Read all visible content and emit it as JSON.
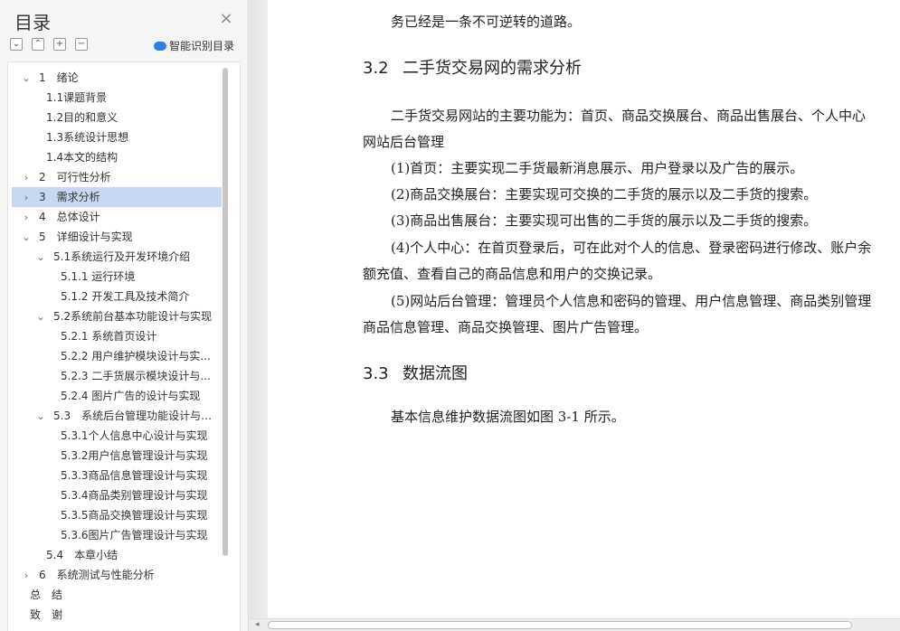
{
  "sidebar": {
    "title": "目录",
    "close_glyph": "×",
    "toolbar": [
      "⌄",
      "⌃",
      "+",
      "−"
    ],
    "smart_toc_label": "智能识别目录",
    "toc": [
      {
        "caret": "⌄",
        "label": "1　绪论",
        "indent": 0
      },
      {
        "caret": "",
        "label": "1.1课题背景",
        "indent": 2
      },
      {
        "caret": "",
        "label": "1.2目的和意义",
        "indent": 2
      },
      {
        "caret": "",
        "label": "1.3系统设计思想",
        "indent": 2
      },
      {
        "caret": "",
        "label": "1.4本文的结构",
        "indent": 2
      },
      {
        "caret": "›",
        "label": "2　可行性分析",
        "indent": 0
      },
      {
        "caret": "›",
        "label": "3　需求分析",
        "indent": 0,
        "active": true
      },
      {
        "caret": "›",
        "label": "4　总体设计",
        "indent": 0
      },
      {
        "caret": "⌄",
        "label": "5　详细设计与实现",
        "indent": 0
      },
      {
        "caret": "⌄",
        "label": "5.1系统运行及开发环境介绍",
        "indent": 1
      },
      {
        "caret": "",
        "label": "5.1.1 运行环境",
        "indent": 3
      },
      {
        "caret": "",
        "label": "5.1.2 开发工具及技术简介",
        "indent": 3
      },
      {
        "caret": "⌄",
        "label": "5.2系统前台基本功能设计与实现",
        "indent": 1
      },
      {
        "caret": "",
        "label": "5.2.1 系统首页设计",
        "indent": 3
      },
      {
        "caret": "",
        "label": "5.2.2 用户维护模块设计与实...",
        "indent": 3
      },
      {
        "caret": "",
        "label": "5.2.3 二手货展示模块设计与...",
        "indent": 3
      },
      {
        "caret": "",
        "label": "5.2.4 图片广告的设计与实现",
        "indent": 3
      },
      {
        "caret": "⌄",
        "label": "5.3　系统后台管理功能设计与实...",
        "indent": 1
      },
      {
        "caret": "",
        "label": "5.3.1个人信息中心设计与实现",
        "indent": 3
      },
      {
        "caret": "",
        "label": "5.3.2用户信息管理设计与实现",
        "indent": 3
      },
      {
        "caret": "",
        "label": "5.3.3商品信息管理设计与实现",
        "indent": 3
      },
      {
        "caret": "",
        "label": "5.3.4商品类别管理设计与实现",
        "indent": 3
      },
      {
        "caret": "",
        "label": "5.3.5商品交换管理设计与实现",
        "indent": 3
      },
      {
        "caret": "",
        "label": "5.3.6图片广告管理设计与实现",
        "indent": 3
      },
      {
        "caret": "",
        "label": "5.4　本章小结",
        "indent": 2
      },
      {
        "caret": "›",
        "label": "6　系统测试与性能分析",
        "indent": 0
      },
      {
        "caret": "",
        "label": "总　结",
        "indent": -1
      },
      {
        "caret": "",
        "label": "致　谢",
        "indent": -1
      }
    ]
  },
  "document": {
    "lines": [
      {
        "id": "top-cut",
        "text": "务已经是一条不可逆转的道路。"
      },
      {
        "id": "h32",
        "num": "3.2",
        "text": "二手货交易网的需求分析"
      },
      {
        "id": "p1a",
        "text": "二手货交易网站的主要功能为：首页、商品交换展台、商品出售展台、个人中心"
      },
      {
        "id": "p1b",
        "text": "网站后台管理"
      },
      {
        "id": "p2",
        "text": "(1)首页：主要实现二手货最新消息展示、用户登录以及广告的展示。"
      },
      {
        "id": "p3",
        "text": "(2)商品交换展台：主要实现可交换的二手货的展示以及二手货的搜索。"
      },
      {
        "id": "p4",
        "text": "(3)商品出售展台：主要实现可出售的二手货的展示以及二手货的搜索。"
      },
      {
        "id": "p5a",
        "text": "(4)个人中心：在首页登录后，可在此对个人的信息、登录密码进行修改、账户余"
      },
      {
        "id": "p5b",
        "text": "额充值、查看自己的商品信息和用户的交换记录。"
      },
      {
        "id": "p6a",
        "text": "(5)网站后台管理：管理员个人信息和密码的管理、用户信息管理、商品类别管理"
      },
      {
        "id": "p6b",
        "text": "商品信息管理、商品交换管理、图片广告管理。"
      },
      {
        "id": "h33",
        "num": "3.3",
        "text": "数据流图"
      },
      {
        "id": "p7",
        "text": "基本信息维护数据流图如图 3-1 所示。"
      }
    ]
  },
  "scrollbar": {
    "arrow": "◂"
  }
}
